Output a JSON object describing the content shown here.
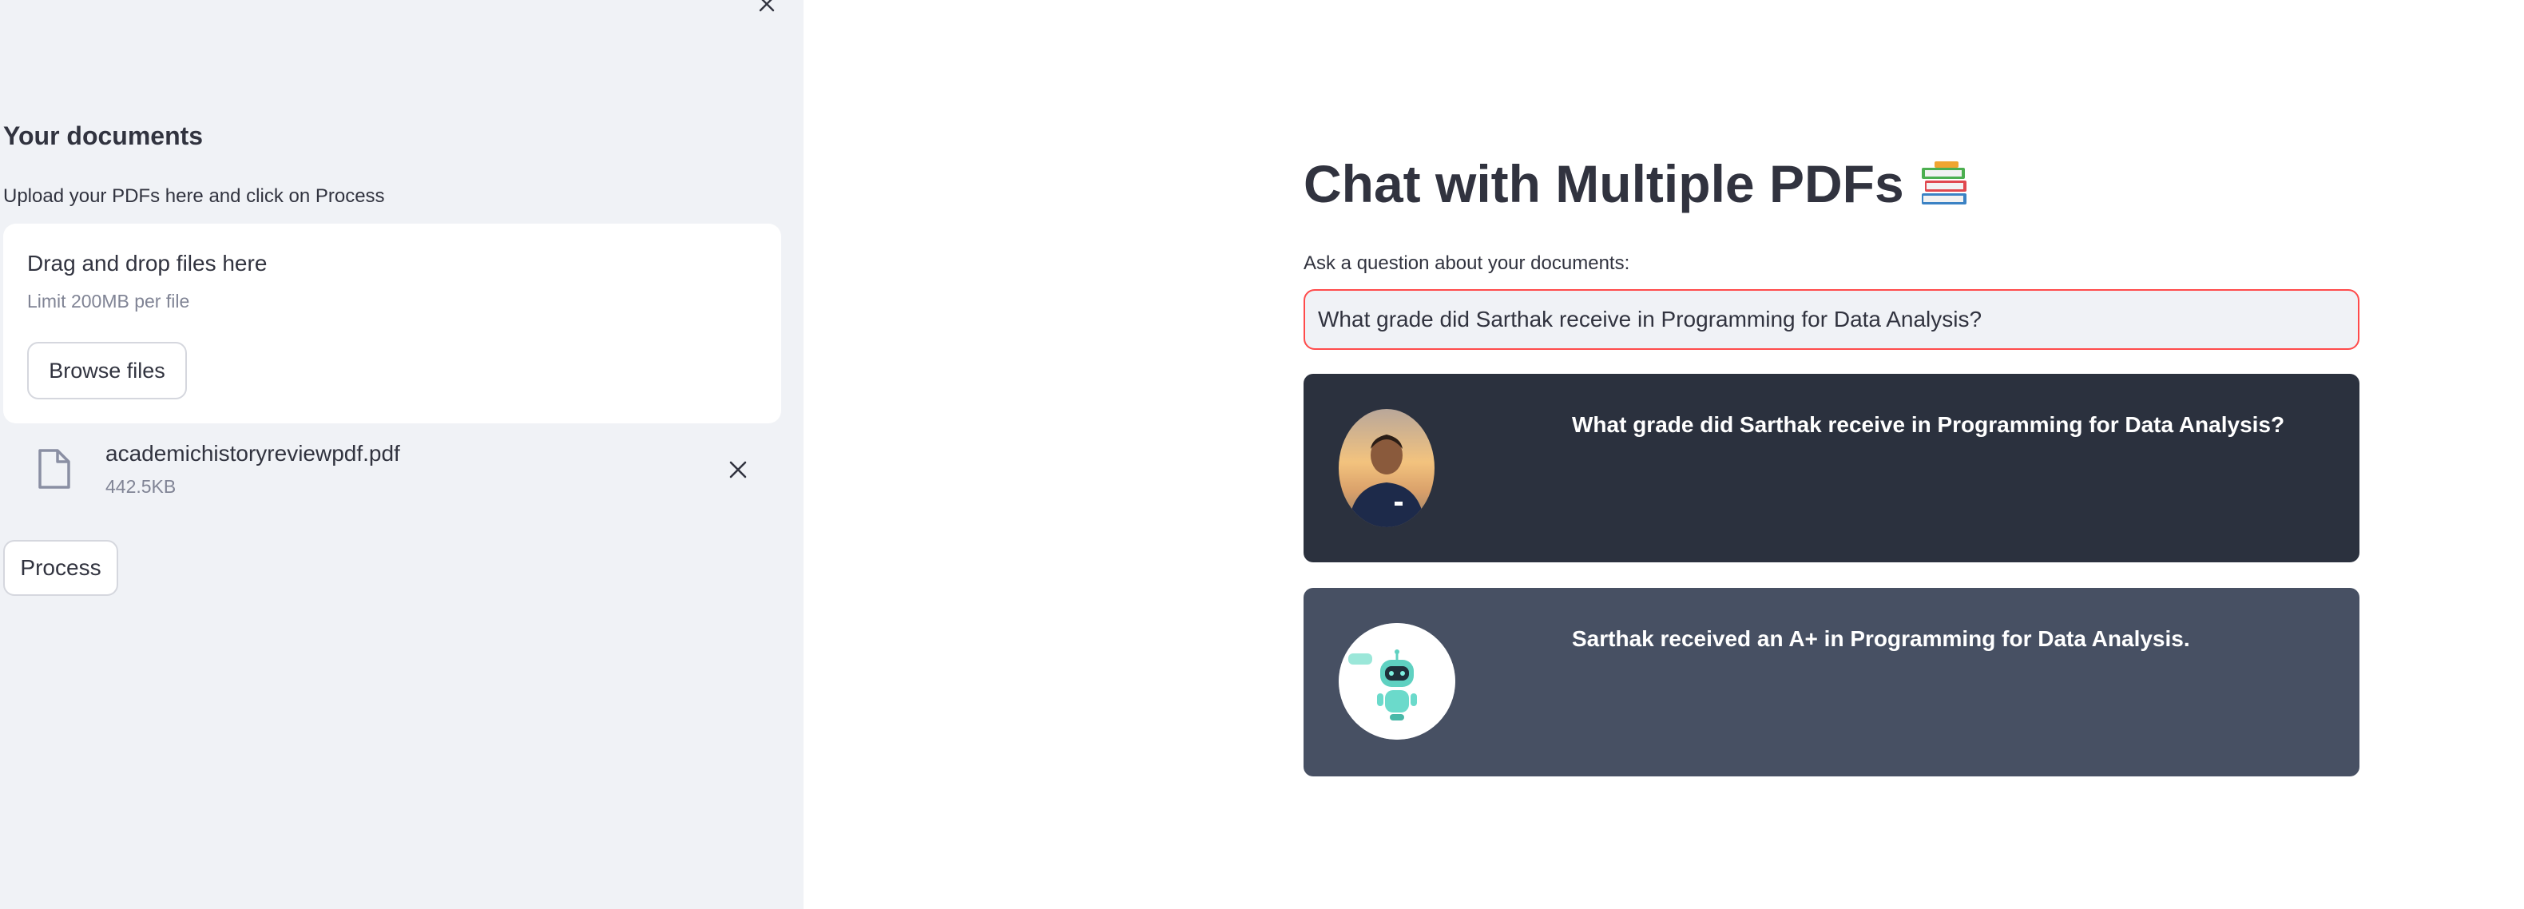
{
  "sidebar": {
    "close_icon": "close-icon",
    "heading": "Your documents",
    "upload_label": "Upload your PDFs here and click on Process",
    "dropzone": {
      "title": "Drag and drop files here",
      "limit": "Limit 200MB per file",
      "browse_label": "Browse files"
    },
    "files": [
      {
        "name": "academichistoryreviewpdf.pdf",
        "size": "442.5KB",
        "icon": "file-icon"
      }
    ],
    "process_label": "Process"
  },
  "main": {
    "title": "Chat with Multiple PDFs",
    "title_icon": "books-icon",
    "question_label": "Ask a question about your documents:",
    "question_value": "What grade did Sarthak receive in Programming for Data Analysis?",
    "messages": [
      {
        "role": "user",
        "avatar": "user-photo-avatar",
        "text": "What grade did Sarthak receive in Programming for Data Analysis?"
      },
      {
        "role": "bot",
        "avatar": "robot-avatar",
        "text": "Sarthak received an A+ in Programming for Data Analysis."
      }
    ]
  },
  "colors": {
    "sidebar_bg": "#f0f2f6",
    "user_msg_bg": "#2b313e",
    "bot_msg_bg": "#475063",
    "input_focus_border": "#ff4b4b",
    "text": "#31333f",
    "muted_text": "#808495"
  }
}
